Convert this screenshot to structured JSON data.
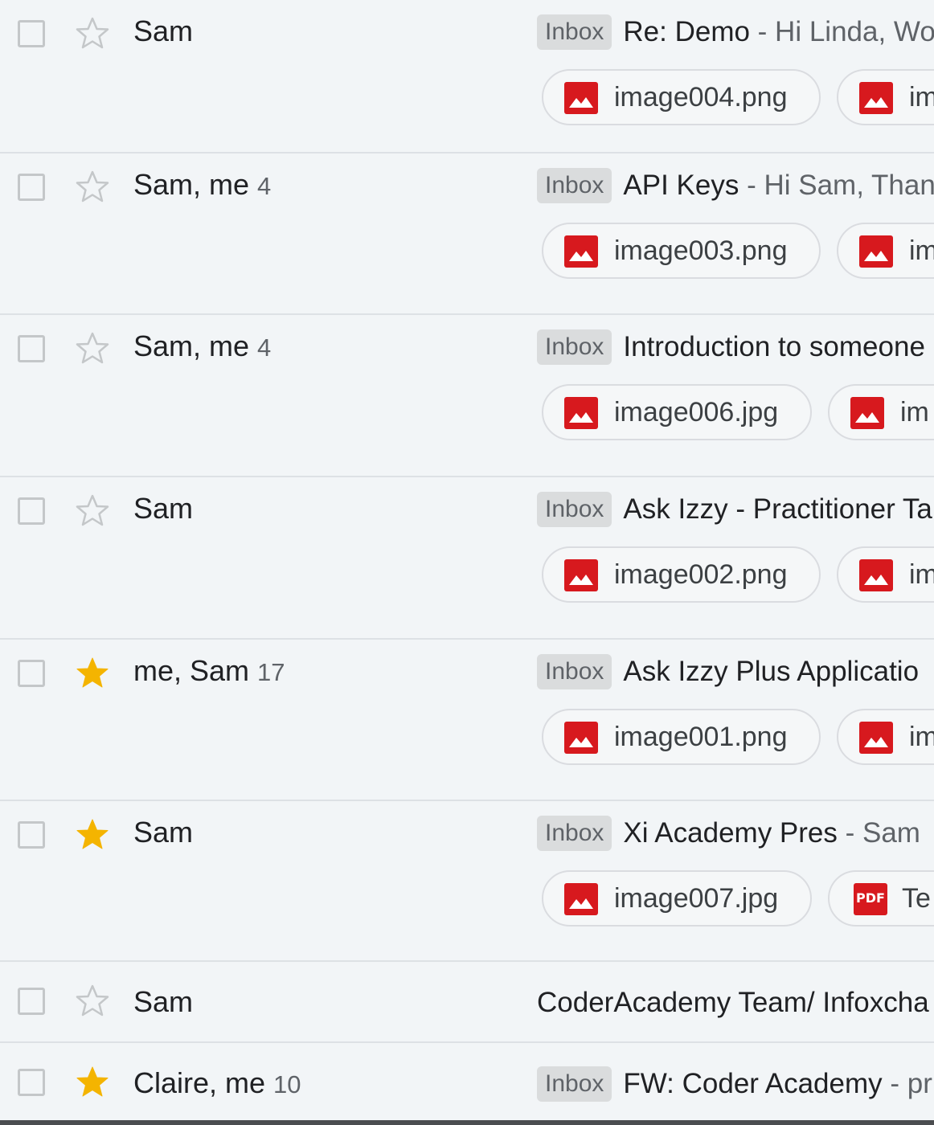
{
  "rows": [
    {
      "sender": "Sam",
      "count": "",
      "starred": false,
      "label": "Inbox",
      "subject": "Re: Demo",
      "snippet": " - Hi Linda, Wo",
      "attachments": [
        {
          "name": "image004.png",
          "type": "image"
        },
        {
          "name": "im",
          "type": "image"
        }
      ]
    },
    {
      "sender": "Sam, me",
      "count": "4",
      "starred": false,
      "label": "Inbox",
      "subject": "API Keys",
      "snippet": " - Hi Sam, Than",
      "attachments": [
        {
          "name": "image003.png",
          "type": "image"
        },
        {
          "name": "im",
          "type": "image"
        }
      ]
    },
    {
      "sender": "Sam, me",
      "count": "4",
      "starred": false,
      "label": "Inbox",
      "subject": "Introduction to someone",
      "snippet": "",
      "attachments": [
        {
          "name": "image006.jpg",
          "type": "image"
        },
        {
          "name": "im",
          "type": "image"
        }
      ]
    },
    {
      "sender": "Sam",
      "count": "",
      "starred": false,
      "label": "Inbox",
      "subject": "Ask Izzy - Practitioner Ta",
      "snippet": "",
      "attachments": [
        {
          "name": "image002.png",
          "type": "image"
        },
        {
          "name": "im",
          "type": "image"
        }
      ]
    },
    {
      "sender": "me, Sam",
      "count": "17",
      "starred": true,
      "label": "Inbox",
      "subject": "Ask Izzy Plus Applicatio",
      "snippet": "",
      "attachments": [
        {
          "name": "image001.png",
          "type": "image"
        },
        {
          "name": "im",
          "type": "image"
        }
      ]
    },
    {
      "sender": "Sam",
      "count": "",
      "starred": true,
      "label": "Inbox",
      "subject": "Xi Academy Pres",
      "snippet": " - Sam",
      "attachments": [
        {
          "name": "image007.jpg",
          "type": "image"
        },
        {
          "name": "Te",
          "type": "pdf"
        }
      ]
    },
    {
      "sender": "Sam",
      "count": "",
      "starred": false,
      "label": "",
      "subject": "CoderAcademy Team/ Infoxcha",
      "snippet": "",
      "attachments": []
    },
    {
      "sender": "Claire, me",
      "count": "10",
      "starred": true,
      "label": "Inbox",
      "subject": "FW: Coder Academy",
      "snippet": " - pr",
      "attachments": []
    }
  ],
  "icons": {
    "star_empty": "star-outline-icon",
    "star_filled": "star-filled-icon",
    "image_file": "image-file-icon",
    "pdf_file": "pdf-file-icon",
    "pdf_badge": "PDF"
  },
  "colors": {
    "star_filled": "#f4b400",
    "star_empty": "#c4c7c9",
    "file_icon": "#d7191e",
    "label_bg": "#dadcdd"
  }
}
